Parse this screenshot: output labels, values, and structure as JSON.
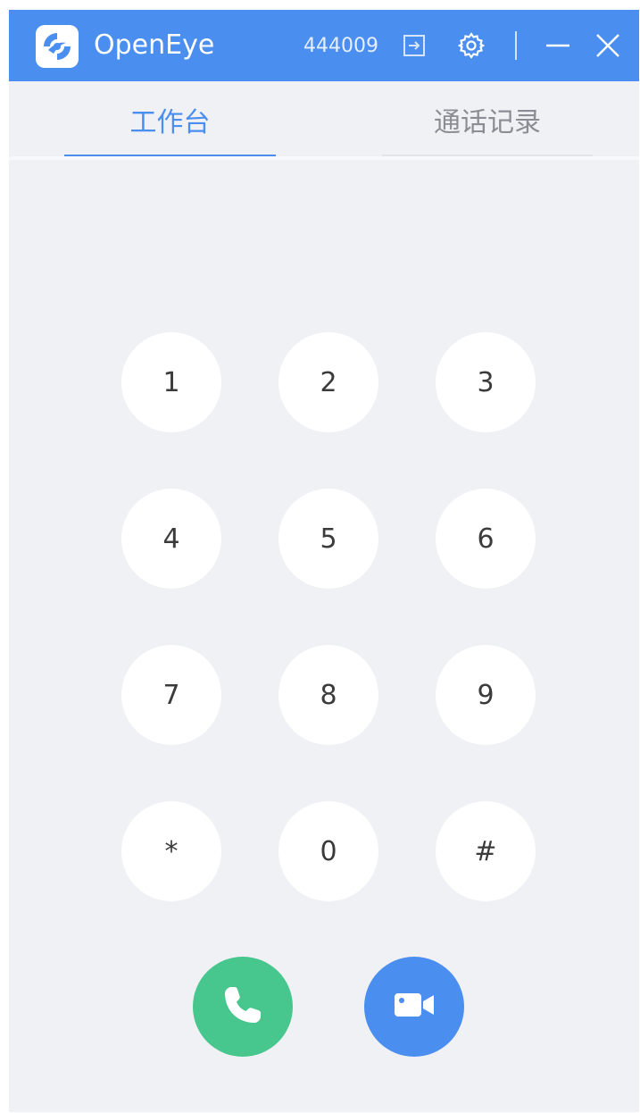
{
  "app": {
    "title": "OpenEye",
    "user_id": "444009",
    "accent_color": "#4a8ef0",
    "icons": [
      "app-logo-icon",
      "logout-icon",
      "gear-icon",
      "minimize-icon",
      "close-icon"
    ]
  },
  "tabs": [
    {
      "label": "工作台",
      "active": true
    },
    {
      "label": "通话记录",
      "active": false
    }
  ],
  "keypad": {
    "keys": [
      "1",
      "2",
      "3",
      "4",
      "5",
      "6",
      "7",
      "8",
      "9",
      "*",
      "0",
      "#"
    ]
  },
  "actions": {
    "audio_call": {
      "icon": "phone-icon",
      "color": "#47c68e"
    },
    "video_call": {
      "icon": "video-camera-icon",
      "color": "#4a8ef0"
    }
  }
}
